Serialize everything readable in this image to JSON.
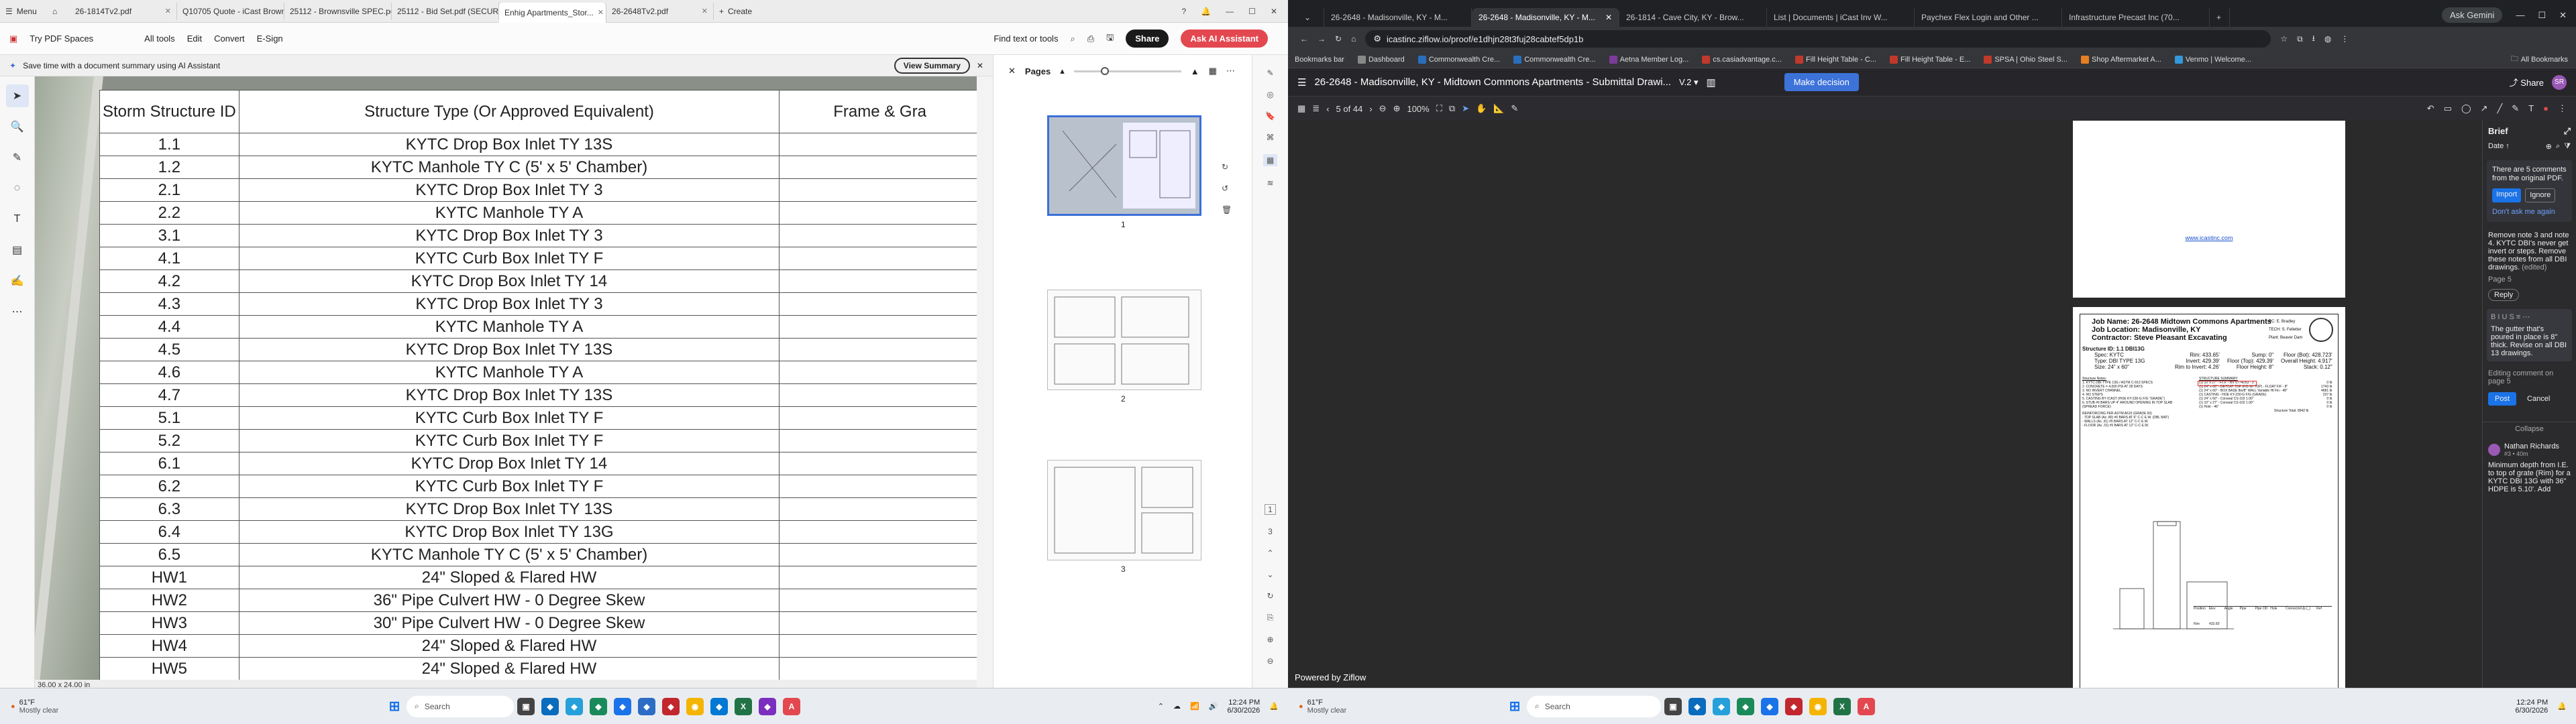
{
  "left": {
    "tabs": [
      "Menu",
      "26-1814Tv2.pdf",
      "Q10705 Quote - iCast Brownsvill...",
      "25112 - Brownsville SPEC.pdf (SE...",
      "25112 - Bid Set.pdf (SECURED)",
      "Enhig Apartments_Stor...",
      "26-2648Tv2.pdf",
      "Create"
    ],
    "menu": {
      "brand": "Try PDF Spaces",
      "items": [
        "All tools",
        "Edit",
        "Convert",
        "E-Sign"
      ],
      "find": "Find text or tools",
      "share": "Share",
      "ai": "Ask AI Assistant"
    },
    "banner": {
      "text": "Save time with a document summary using AI Assistant",
      "btn": "View Summary"
    },
    "table": {
      "headers": [
        "Storm Structure ID",
        "Structure Type (Or Approved Equivalent)",
        "Frame & Gra"
      ],
      "rows": [
        [
          "1.1",
          "KYTC Drop Box Inlet TY 13S"
        ],
        [
          "1.2",
          "KYTC Manhole TY C (5' x 5' Chamber)"
        ],
        [
          "2.1",
          "KYTC Drop Box Inlet TY 3"
        ],
        [
          "2.2",
          "KYTC Manhole TY A"
        ],
        [
          "3.1",
          "KYTC Drop Box Inlet TY 3"
        ],
        [
          "4.1",
          "KYTC Curb Box Inlet TY F"
        ],
        [
          "4.2",
          "KYTC Drop Box Inlet TY 14"
        ],
        [
          "4.3",
          "KYTC Drop Box Inlet TY 3"
        ],
        [
          "4.4",
          "KYTC Manhole TY A"
        ],
        [
          "4.5",
          "KYTC Drop Box Inlet TY 13S"
        ],
        [
          "4.6",
          "KYTC Manhole TY  A"
        ],
        [
          "4.7",
          "KYTC Drop Box Inlet TY 13S"
        ],
        [
          "5.1",
          "KYTC Curb Box Inlet TY F"
        ],
        [
          "5.2",
          "KYTC Curb Box Inlet TY F"
        ],
        [
          "6.1",
          "KYTC Drop Box Inlet TY 14"
        ],
        [
          "6.2",
          "KYTC Curb Box Inlet TY F"
        ],
        [
          "6.3",
          "KYTC Drop Box Inlet TY 13S"
        ],
        [
          "6.4",
          "KYTC Drop Box Inlet TY 13G"
        ],
        [
          "6.5",
          "KYTC Manhole TY C (5' x 5' Chamber)"
        ],
        [
          "HW1",
          "24\" Sloped & Flared HW"
        ],
        [
          "HW2",
          "36\"  Pipe Culvert HW - 0 Degree Skew"
        ],
        [
          "HW3",
          "30\" Pipe Culvert HW - 0 Degree Skew"
        ],
        [
          "HW4",
          "24\" Sloped & Flared HW"
        ],
        [
          "HW5",
          "24\" Sloped & Flared HW"
        ]
      ]
    },
    "pages": {
      "label": "Pages",
      "nums": [
        "1",
        "2",
        "3"
      ],
      "cur": "1",
      "total": "3"
    },
    "status": "36.00 x 24.00 in",
    "weather": {
      "temp": "61°F",
      "desc": "Mostly clear"
    },
    "search": "Search",
    "clock": {
      "time": "12:24 PM",
      "date": "6/30/2026"
    }
  },
  "right": {
    "tabs": [
      "26-2648 - Madisonville, KY - M...",
      "26-2648 - Madisonville, KY - M...",
      "26-1814 - Cave City, KY - Brow...",
      "List | Documents | iCast Inv W...",
      "Paychex Flex Login and Other ...",
      "Infrastructure Precast Inc (70...",
      "Ask Gemini"
    ],
    "url": "icastinc.ziflow.io/proof/e1dhjn28t3fuj28cabtef5dp1b",
    "bookmarks": [
      "Bookmarks bar",
      "Dashboard",
      "Commonwealth Cre...",
      "Commonwealth Cre...",
      "Aetna Member Log...",
      "cs.casiadvantage.c...",
      "Fill Height Table - C...",
      "Fill Height Table - E...",
      "SPSA | Ohio Steel S...",
      "Shop Aftermarket A...",
      "Venmo | Welcome...",
      "All Bookmarks"
    ],
    "title": "26-2648 - Madisonville, KY - Midtown Commons Apartments - Submittal Drawi...",
    "version": "V.2",
    "decision": "Make decision",
    "share": "Share",
    "pager": "5 of 44",
    "zoom": "100%",
    "link": "www.icastinc.com",
    "sheet": {
      "job": "Job Name: 26-2648 Midtown Commons Apartments",
      "loc": "Job Location: Madisonville, KY",
      "contractor": "Contractor: Steve Pleasant Excavating",
      "pc": "PC:",
      "pcv": "E. Bradley",
      "tech": "TECH:",
      "techv": "S. Felletter",
      "plant": "Plant: Beaver Dam",
      "sid": "Structure ID: 1.1 DBI13G",
      "spec": "Spec: KYTC",
      "type": "Type: DBI TYPE 13G",
      "size": "Size: 24\" x 60\"",
      "rim": "Rim: 433.65'",
      "inv": "Invert: 429.39'",
      "rimtoinv": "Rim to Invert: 4.26'",
      "sump": "Sump: 0\"",
      "floortop": "Floor (Top): 429.39'",
      "floorh": "Floor Height: 8\"",
      "floorbot": "Floor (Bot): 428.723'",
      "overall": "Overall Height: 4.917'",
      "stack": "Stack: 0.12\"",
      "notes_h": "Structure Notes:",
      "notes": [
        "1. KYTC DBI TYPE 13G / ASTM C-913 SPECS",
        "2. CONCRETE = 4,000 PSI AT 28 DAYS",
        "3. NO INVERT CHANNEL",
        "4. NO STEPS",
        "5. CASTING BY ICAST (HOE KY-230-G F/G \"GRADE\")",
        "6. STUB #6 BARS UP 4\" AROUND OPENING IN TOP SLAB",
        "(SPREAD FORCE)"
      ],
      "reinf": [
        "REINFORCING PER ASTM A615 (GRADE 60)",
        "- TOP SLAB (As .80) #6 BARS AT 6\" C-C E.W. (DBL MAT)",
        "- WALLS (As .31) #5 BARS AT 12\" C-C E.W.",
        "- FLOOR (As .31) #5 BARS AT 12\" C-C E.W."
      ],
      "summary_h": "STRUCTURE SUMMARY",
      "summary": [
        "(1) 10' x 27\" - F.I.F. - BV 0774D53 - 3\"",
        "(1) 24\" x 60\" - DETCAT TOP (F/B W/ TOP) - FLOAT F/F - 8\"",
        "(1) 24\" x 60\" - BOX BASE 8in/8\" WALL Variable Ht Fin - 48\"",
        "(1)  CASTING - HOE KY-230-G F/G (GRADE)",
        "(1)  24\" x 60\" - Conseal CS-102 1.00\"",
        "(1)  10\" x 27\" - Conseal CS-102 1.00\"",
        "(1)  Hole - 46\""
      ],
      "wts": [
        "0 lb",
        "1743 lb",
        "4681 lb",
        "237 lb",
        "0 lb",
        "0 lb",
        "0 lb"
      ],
      "total": "Structure Total:",
      "totalv": "8942 lb",
      "tblh": [
        "Position",
        "Elev",
        "Angle",
        "Pipe",
        "Pipe OD",
        "Hole",
        "Connector",
        "Up (_)",
        "Ref"
      ],
      "rimrow": [
        "Rim",
        "433.65'"
      ]
    },
    "powered": "Powered by Ziflow",
    "brief": {
      "title": "Brief",
      "sort": "Date",
      "comments_note": "There are 5 comments from the original PDF.",
      "import": "Import",
      "ignore": "Ignore",
      "dont": "Don't ask me again",
      "c1": "Remove note 3 and note 4. KYTC DBI's never get invert or steps. Remove these notes from all DBI drawings.",
      "edited": "(edited)",
      "page": "Page 5",
      "reply": "Reply",
      "editor": "The gutter that's poured in place is 8\" thick. Revise on all DBI 13 drawings.",
      "editing": "Editing comment on page 5",
      "post": "Post",
      "cancel": "Cancel",
      "collapse": "Collapse",
      "author": "Nathan Richards",
      "ago": "#3 • 40m",
      "c2": "Minimum depth from I.E. to top of grate (Rim) for a KYTC DBI 13G with 36\" HDPE is 5.10'. Add"
    },
    "weather": {
      "temp": "61°F",
      "desc": "Mostly clear"
    },
    "search": "Search",
    "clock": {
      "time": "12:24 PM",
      "date": "6/30/2026"
    }
  },
  "colors": {
    "accent": "#3b6fd8",
    "share": "#1a1a1a",
    "ai": "#e34850",
    "decision": "#3d72d9",
    "post": "#1a73e8"
  }
}
